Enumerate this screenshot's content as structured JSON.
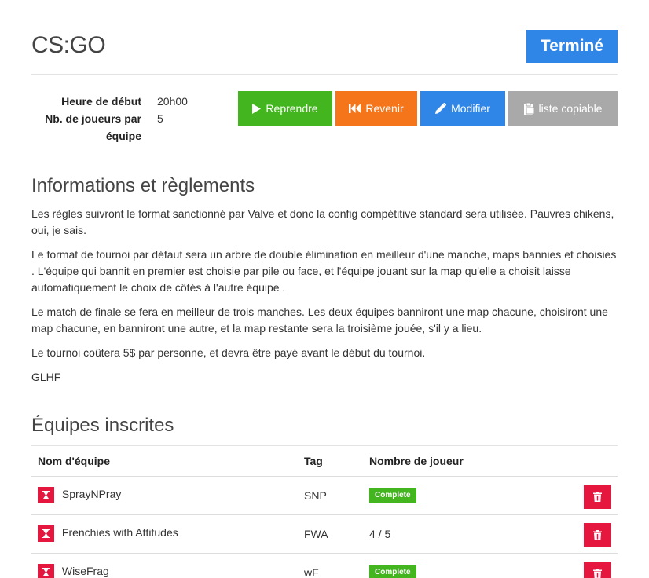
{
  "header": {
    "title": "CS:GO",
    "status": "Terminé"
  },
  "meta": {
    "start_label": "Heure de début",
    "start_value": "20h00",
    "players_label": "Nb. de joueurs par équipe",
    "players_value": "5"
  },
  "actions": {
    "resume": "Reprendre",
    "back": "Revenir",
    "edit": "Modifier",
    "copy": "liste copiable"
  },
  "rules": {
    "title": "Informations et règlements",
    "paragraphs": [
      "Les règles suivront le format sanctionné par Valve et donc la config compétitive standard sera utilisée. Pauvres chikens, oui, je sais.",
      "Le format de tournoi par défaut sera un arbre de double élimination en meilleur d'une manche, maps bannies et choisies . L'équipe qui bannit en premier est choisie par pile ou face, et l'équipe jouant sur la map qu'elle a choisit laisse automatiquement le choix de côtés à l'autre équipe .",
      "Le match de finale se fera en meilleur de trois manches. Les deux équipes banniront une map chacune, choisiront une map chacune, en banniront une autre, et la map restante sera la troisième jouée, s'il y a lieu.",
      "Le tournoi coûtera 5$ par personne, et devra être payé avant le début du tournoi.",
      "GLHF"
    ]
  },
  "teams": {
    "title": "Équipes inscrites",
    "columns": [
      "Nom d'équipe",
      "Tag",
      "Nombre de joueur"
    ],
    "rows": [
      {
        "name": "SprayNPray",
        "tag": "SNP",
        "players": "Complete"
      },
      {
        "name": "Frenchies with Attitudes",
        "tag": "FWA",
        "players": "4 / 5"
      },
      {
        "name": "WiseFrag",
        "tag": "wF",
        "players": "Complete"
      }
    ]
  },
  "colors": {
    "primary": "#2f86e6",
    "success": "#43b51f",
    "warning": "#f5761a",
    "muted": "#a9a9a9",
    "danger": "#e5173f"
  }
}
